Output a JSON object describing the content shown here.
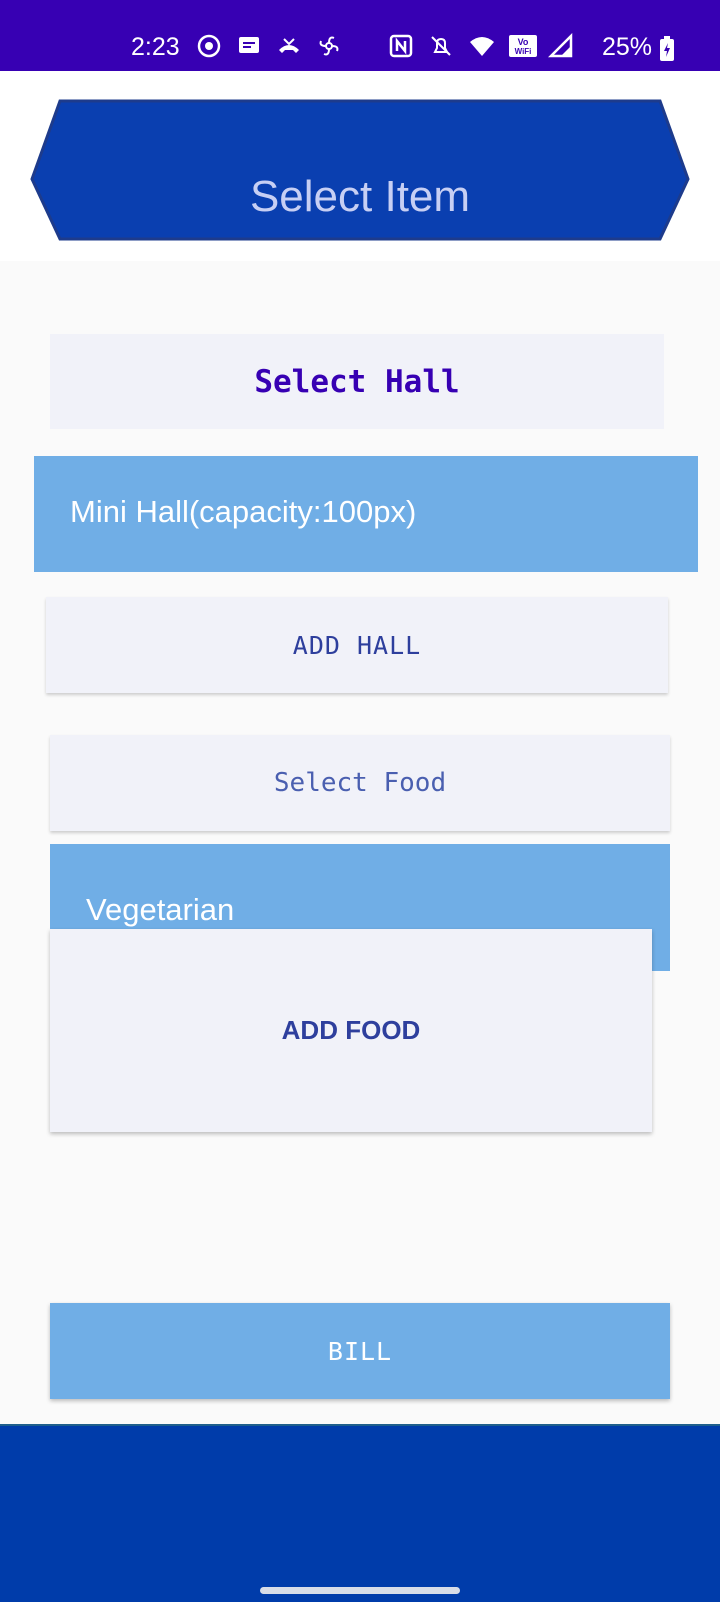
{
  "status_bar": {
    "time": "2:23",
    "battery": "25%",
    "left_icons": [
      "whatsapp-icon",
      "message-icon",
      "missed-call-icon",
      "pinwheel-icon"
    ],
    "right_icons": [
      "nfc-icon",
      "vibrate-icon",
      "wifi-icon",
      "vowifi-icon",
      "signal-icon",
      "battery-charging-icon"
    ]
  },
  "header": {
    "title": "Select Item",
    "banner_color": "#0a3fb0"
  },
  "hall": {
    "section_label": "Select Hall",
    "selected": "Mini Hall(capacity:100px)",
    "add_button": "ADD HALL"
  },
  "food": {
    "section_label": "Select Food",
    "selected": "Vegetarian",
    "add_button": "ADD FOOD"
  },
  "bill_button": "BILL",
  "colors": {
    "status_bar": "#3700b3",
    "spinner": "#70aee6",
    "button_bg": "#f1f2f9",
    "bottom_band": "#003caa"
  }
}
